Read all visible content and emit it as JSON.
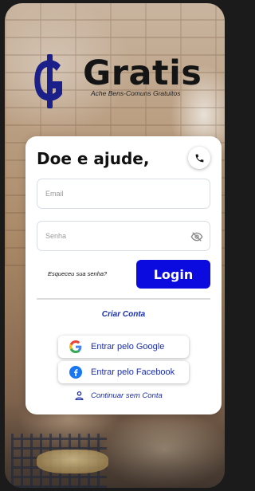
{
  "brand": {
    "name": "Gratis",
    "tagline": "Ache Bens-Comuns Gratuitos",
    "mark_color": "#1a1f8a"
  },
  "login_card": {
    "title": "Doe e ajude,",
    "call_icon": "phone-icon",
    "email": {
      "placeholder": "Email",
      "value": ""
    },
    "password": {
      "placeholder": "Senha",
      "value": "",
      "visibility_icon": "eye-off-icon"
    },
    "forgot_link": "Esqueceu sua senha?",
    "login_button": "Login",
    "create_account": "Criar Conta",
    "google_button": "Entrar pelo Google",
    "facebook_button": "Entrar pelo Facebook",
    "guest_link": "Continuar sem Conta",
    "guest_icon": "person-icon"
  },
  "colors": {
    "primary": "#0b0bdf",
    "link": "#1d2ea8",
    "facebook": "#1877f2"
  }
}
